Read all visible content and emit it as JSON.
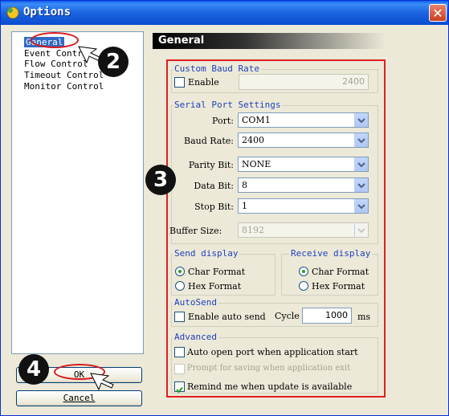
{
  "window": {
    "title": "Options",
    "close_symbol": "✕"
  },
  "tree": {
    "items": [
      "General",
      "Event Control",
      "Flow Control",
      "Timeout Control",
      "Monitor Control"
    ]
  },
  "buttons": {
    "ok": "OK",
    "cancel": "Cancel"
  },
  "panel": {
    "title": "General"
  },
  "custom_baud": {
    "legend": "Custom Baud Rate",
    "enable_label": "Enable",
    "enable_checked": false,
    "value": "2400"
  },
  "serial": {
    "legend": "Serial Port Settings",
    "port_label": "Port:",
    "port_value": "COM1",
    "baud_label": "Baud Rate:",
    "baud_value": "2400",
    "parity_label": "Parity Bit:",
    "parity_value": "NONE",
    "data_label": "Data Bit:",
    "data_value": "8",
    "stop_label": "Stop Bit:",
    "stop_value": "1",
    "buffer_label": "Buffer Size:",
    "buffer_value": "8192"
  },
  "send_display": {
    "legend": "Send display",
    "char": "Char Format",
    "hex": "Hex  Format",
    "selected": "char"
  },
  "receive_display": {
    "legend": "Receive display",
    "char": "Char Format",
    "hex": "Hex  Format",
    "selected": "char"
  },
  "autosend": {
    "legend": "AutoSend",
    "enable_label": "Enable auto send",
    "cycle_label": "Cycle",
    "cycle_value": "1000",
    "unit": "ms"
  },
  "advanced": {
    "legend": "Advanced",
    "auto_open": "Auto open port when application start",
    "prompt_save": "Prompt for saving when application exit",
    "remind_update": "Remind me when update is available",
    "remind_checked": true
  },
  "annotations": {
    "step2": "2",
    "step3": "3",
    "step4": "4"
  },
  "colors": {
    "titlebar": "#0a5ae8",
    "annotation_red": "#e01f1f",
    "legend_blue": "#1f3fbf"
  }
}
